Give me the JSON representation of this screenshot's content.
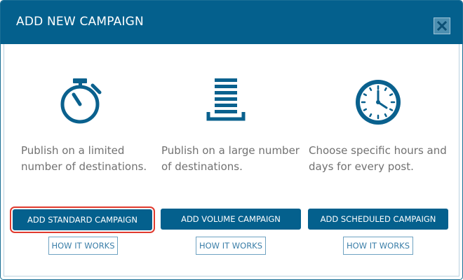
{
  "dialog": {
    "title": "ADD NEW CAMPAIGN",
    "close_icon": "close-icon"
  },
  "options": [
    {
      "icon": "stopwatch-icon",
      "description": "Publish on a limited number of destinations.",
      "button_label": "ADD STANDARD CAMPAIGN",
      "how_label": "HOW IT WORKS",
      "selected": true
    },
    {
      "icon": "list-stack-icon",
      "description": "Publish on a large number of destinations.",
      "button_label": "ADD VOLUME CAMPAIGN",
      "how_label": "HOW IT WORKS",
      "selected": false
    },
    {
      "icon": "clock-icon",
      "description": "Choose specific hours and days for every post.",
      "button_label": "ADD SCHEDULED CAMPAIGN",
      "how_label": "HOW IT WORKS",
      "selected": false
    }
  ],
  "colors": {
    "brand": "#04608d",
    "description_text": "#717171",
    "selected_outline": "#e03a2e"
  }
}
